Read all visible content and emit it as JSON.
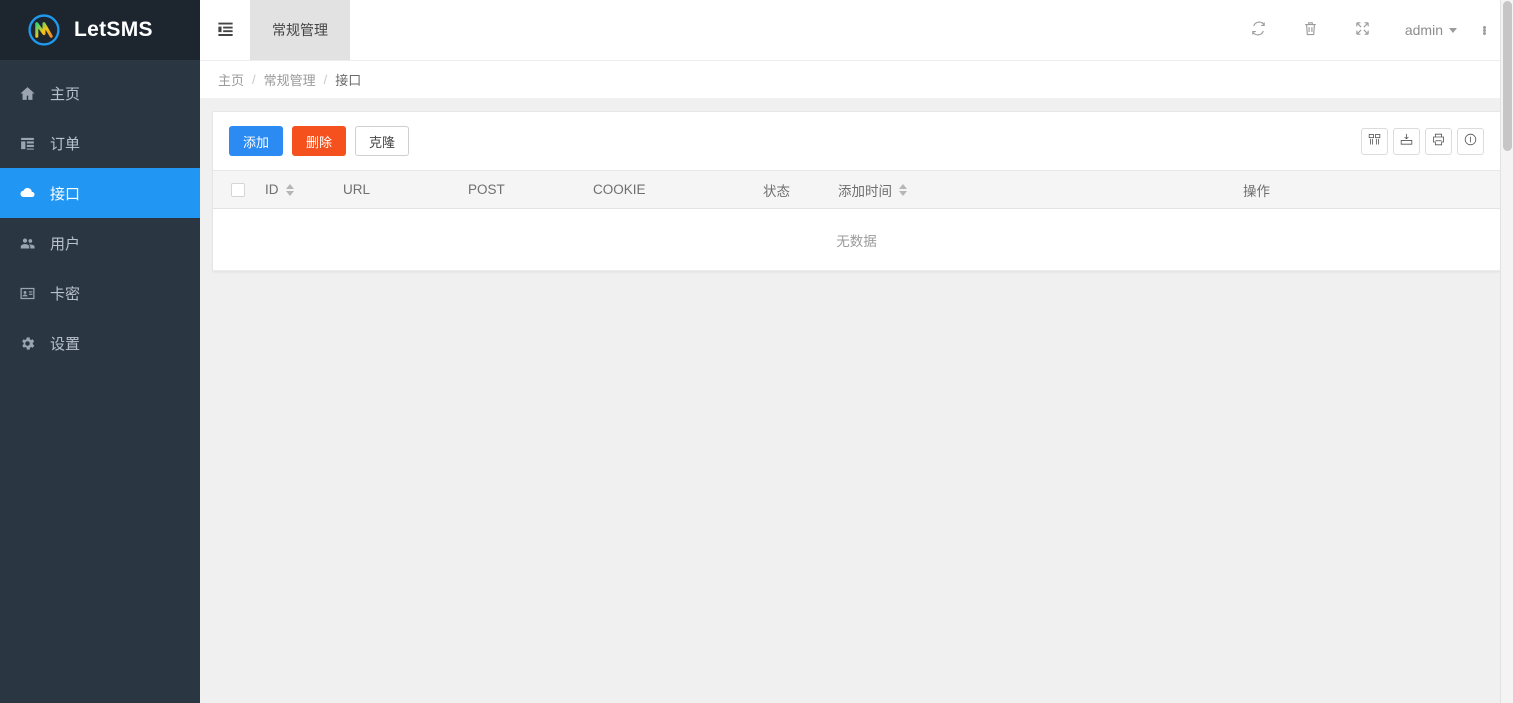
{
  "brand": {
    "name": "LetSMS",
    "logo_icon": "letsms-logo-icon"
  },
  "sidebar": {
    "items": [
      {
        "label": "主页",
        "icon": "home-icon",
        "active": false
      },
      {
        "label": "订单",
        "icon": "list-icon",
        "active": false
      },
      {
        "label": "接口",
        "icon": "cloud-icon",
        "active": true
      },
      {
        "label": "用户",
        "icon": "users-icon",
        "active": false
      },
      {
        "label": "卡密",
        "icon": "id-card-icon",
        "active": false
      },
      {
        "label": "设置",
        "icon": "gear-icon",
        "active": false
      }
    ]
  },
  "topbar": {
    "collapse_icon": "indent-list-icon",
    "tabs": [
      {
        "label": "常规管理",
        "active": true
      }
    ],
    "icons": [
      {
        "name": "refresh-icon"
      },
      {
        "name": "trash-icon"
      },
      {
        "name": "fullscreen-icon"
      }
    ],
    "user": {
      "name": "admin",
      "caret_icon": "chevron-down-icon"
    },
    "overflow_icon": "more-vertical-icon"
  },
  "breadcrumb": {
    "items": [
      "主页",
      "常规管理",
      "接口"
    ],
    "separator": "/"
  },
  "toolbar": {
    "buttons": [
      {
        "label": "添加",
        "style": "primary"
      },
      {
        "label": "删除",
        "style": "danger"
      },
      {
        "label": "克隆",
        "style": "default"
      }
    ],
    "icon_buttons": [
      {
        "name": "columns-icon"
      },
      {
        "name": "export-icon"
      },
      {
        "name": "print-icon"
      },
      {
        "name": "info-icon"
      }
    ]
  },
  "table": {
    "select_all_checkbox": false,
    "columns": [
      {
        "label": "",
        "key": "checkbox",
        "sortable": false
      },
      {
        "label": "ID",
        "key": "id",
        "sortable": true
      },
      {
        "label": "URL",
        "key": "url",
        "sortable": false
      },
      {
        "label": "POST",
        "key": "post",
        "sortable": false
      },
      {
        "label": "COOKIE",
        "key": "cookie",
        "sortable": false
      },
      {
        "label": "状态",
        "key": "status",
        "sortable": false
      },
      {
        "label": "添加时间",
        "key": "created",
        "sortable": true
      },
      {
        "label": "操作",
        "key": "action",
        "sortable": false
      }
    ],
    "rows": [],
    "empty_text": "无数据"
  },
  "colors": {
    "accent": "#2196f3",
    "sidebar_bg": "#2b3643",
    "sidebar_header_bg": "#1d252f",
    "primary_button": "#2b8bf2",
    "danger_button": "#f4511e",
    "page_bg": "#f0f0f0",
    "tab_active_bg": "#e2e2e2"
  }
}
